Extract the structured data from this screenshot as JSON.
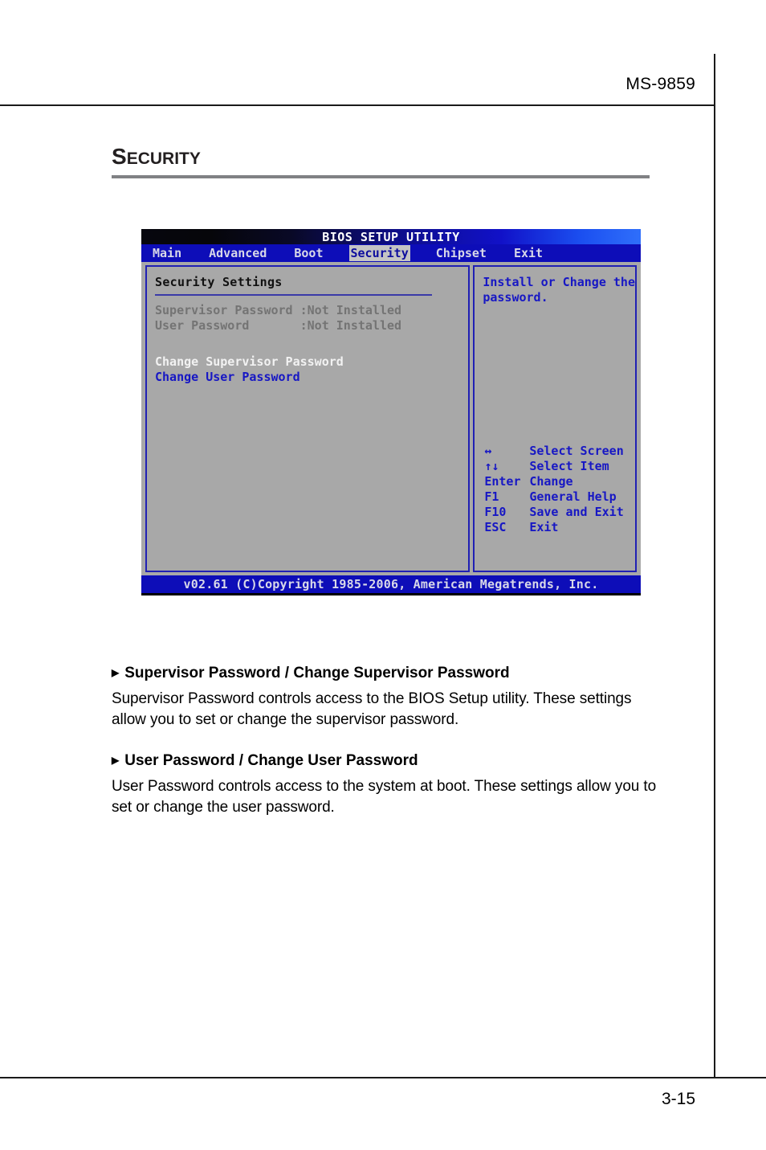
{
  "page": {
    "header_label": "MS-9859",
    "section_title_cap": "S",
    "section_title_rest": "ECURITY",
    "page_number": "3-15"
  },
  "colors": {
    "bios_blue": "#0d0db8",
    "panel_border": "#2020b4",
    "panel_bg": "#a8a8a8",
    "help_text": "#1717c4",
    "dim_text": "#747474",
    "selected_text": "#f2f2f2",
    "rule_grey": "#808184"
  },
  "bios": {
    "title": "BIOS SETUP UTILITY",
    "menu": [
      {
        "label": "Main",
        "active": false
      },
      {
        "label": "Advanced",
        "active": false
      },
      {
        "label": "Boot",
        "active": false
      },
      {
        "label": "Security",
        "active": true
      },
      {
        "label": "Chipset",
        "active": false
      },
      {
        "label": "Exit",
        "active": false
      }
    ],
    "left_panel": {
      "heading": "Security Settings",
      "status_rows": [
        {
          "label": "Supervisor Password",
          "value": ":Not Installed",
          "text": "Supervisor Password :Not Installed"
        },
        {
          "label": "User Password",
          "value": ":Not Installed",
          "text": "User Password       :Not Installed"
        }
      ],
      "actions": [
        {
          "label": "Change Supervisor Password",
          "state": "selected"
        },
        {
          "label": "Change User Password",
          "state": "normal"
        }
      ]
    },
    "right_panel": {
      "help_line_1": "Install or Change the",
      "help_line_2": "password.",
      "keys": [
        {
          "key": "↔",
          "desc": "Select Screen"
        },
        {
          "key": "↑↓",
          "desc": "Select Item"
        },
        {
          "key": "Enter",
          "desc": "Change"
        },
        {
          "key": "F1",
          "desc": "General Help"
        },
        {
          "key": "F10",
          "desc": "Save and Exit"
        },
        {
          "key": "ESC",
          "desc": "Exit"
        }
      ]
    },
    "footer": "v02.61 (C)Copyright 1985-2006, American Megatrends, Inc."
  },
  "content": {
    "bullet_glyph": "▶",
    "blocks": [
      {
        "heading": "Supervisor Password / Change Supervisor Password",
        "body": "Supervisor Password controls access to the BIOS Setup utility. These settings allow you to set or change the supervisor password."
      },
      {
        "heading": "User Password / Change User Password",
        "body": "User Password controls access to the system at boot. These settings allow you to set or change the user password."
      }
    ]
  }
}
